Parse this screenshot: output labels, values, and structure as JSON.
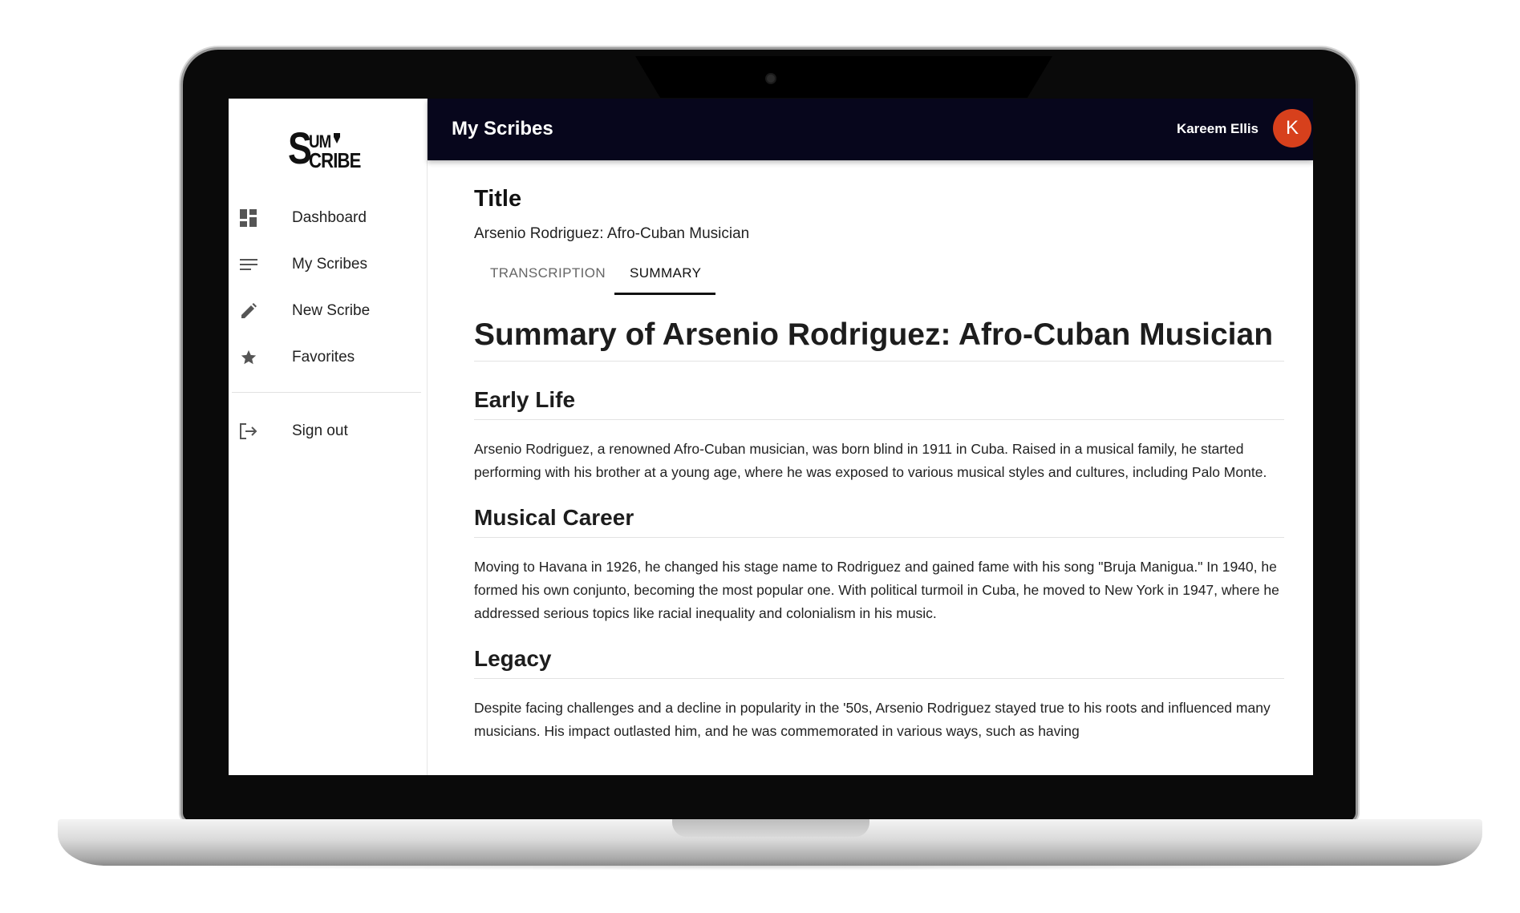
{
  "app": {
    "logo_top": "UM",
    "logo_bottom": "CRIBE",
    "logo_s": "S"
  },
  "sidebar": {
    "items": [
      {
        "label": "Dashboard",
        "icon": "dashboard-icon"
      },
      {
        "label": "My Scribes",
        "icon": "list-icon"
      },
      {
        "label": "New Scribe",
        "icon": "pencil-icon"
      },
      {
        "label": "Favorites",
        "icon": "star-icon"
      }
    ],
    "signout": {
      "label": "Sign out",
      "icon": "logout-icon"
    }
  },
  "header": {
    "page_title": "My Scribes",
    "user_name": "Kareem Ellis",
    "avatar_initial": "K",
    "avatar_color": "#d7401c",
    "bar_color": "#07061c"
  },
  "main": {
    "title_label": "Title",
    "title_value": "Arsenio Rodriguez: Afro-Cuban Musician",
    "tabs": [
      {
        "label": "TRANSCRIPTION",
        "active": false
      },
      {
        "label": "SUMMARY",
        "active": true
      }
    ],
    "summary": {
      "heading": "Summary of Arsenio Rodriguez: Afro-Cuban Musician",
      "sections": [
        {
          "heading": "Early Life",
          "text": "Arsenio Rodriguez, a renowned Afro-Cuban musician, was born blind in 1911 in Cuba. Raised in a musical family, he started performing with his brother at a young age, where he was exposed to various musical styles and cultures, including Palo Monte."
        },
        {
          "heading": "Musical Career",
          "text": "Moving to Havana in 1926, he changed his stage name to Rodriguez and gained fame with his song \"Bruja Manigua.\" In 1940, he formed his own conjunto, becoming the most popular one. With political turmoil in Cuba, he moved to New York in 1947, where he addressed serious topics like racial inequality and colonialism in his music."
        },
        {
          "heading": "Legacy",
          "text": "Despite facing challenges and a decline in popularity in the '50s, Arsenio Rodriguez stayed true to his roots and influenced many musicians. His impact outlasted him, and he was commemorated in various ways, such as having"
        }
      ]
    }
  }
}
